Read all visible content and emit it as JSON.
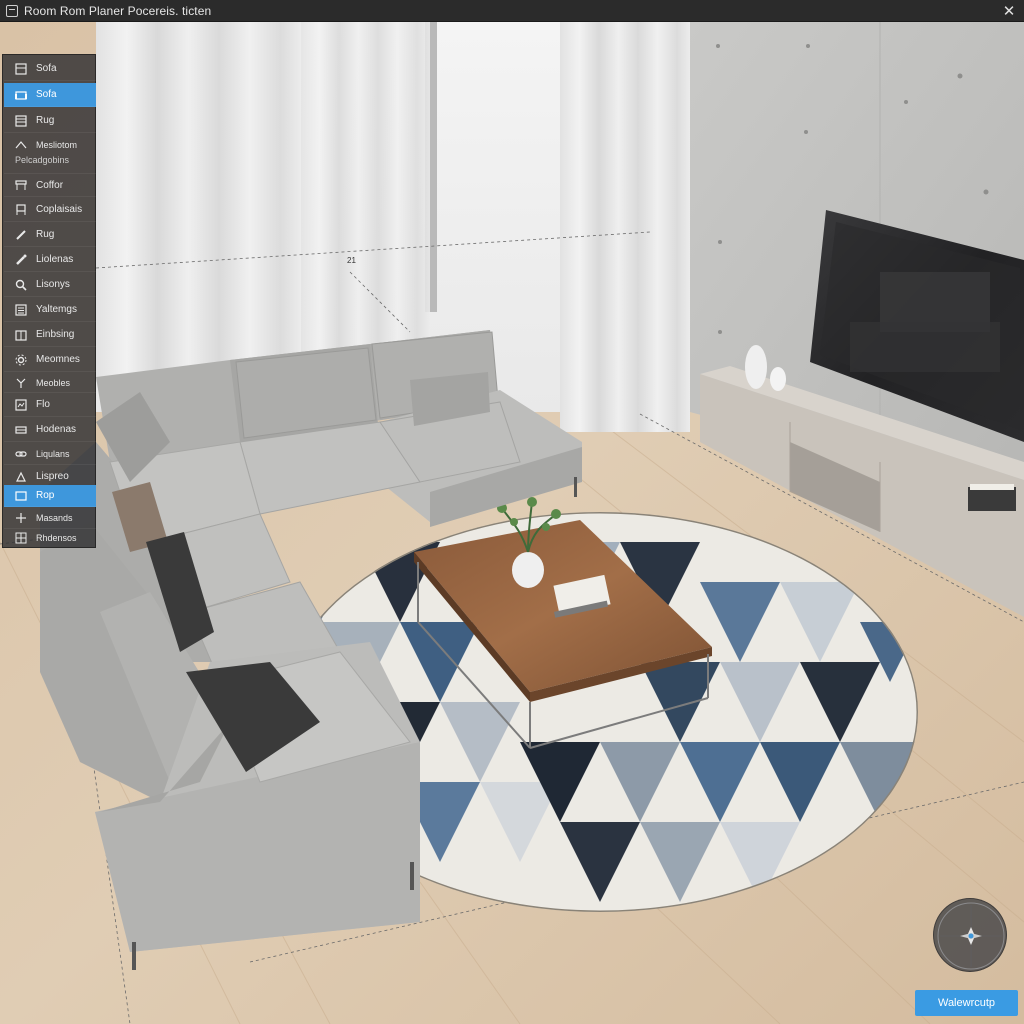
{
  "window": {
    "title": "Room Rom Planer Pocereis. ticten"
  },
  "palette": {
    "items": [
      {
        "label": "Sofa",
        "icon": "sofa-icon",
        "active": false
      },
      {
        "label": "Sofa",
        "icon": "sofa-icon",
        "active": true
      },
      {
        "label": "Rug",
        "icon": "rug-icon",
        "active": false
      },
      {
        "label": "Mesliotom",
        "icon": "measure-icon",
        "active": false
      },
      {
        "label": "Coffor",
        "icon": "table-icon",
        "active": false
      },
      {
        "label": "Coplaisais",
        "icon": "chair-icon",
        "active": false
      },
      {
        "label": "Rug",
        "icon": "pencil-icon",
        "active": false
      },
      {
        "label": "Liolenas",
        "icon": "brush-icon",
        "active": false
      },
      {
        "label": "Lisonys",
        "icon": "search-icon",
        "active": false
      },
      {
        "label": "Yaltemgs",
        "icon": "list-icon",
        "active": false
      },
      {
        "label": "Einbsing",
        "icon": "cabinet-icon",
        "active": false
      },
      {
        "label": "Meomnes",
        "icon": "settings-icon",
        "active": false
      },
      {
        "label": "Meobles",
        "icon": "plant-icon",
        "active": false
      },
      {
        "label": "Flo",
        "icon": "floor-icon",
        "active": false
      },
      {
        "label": "Hodenas",
        "icon": "shelf-icon",
        "active": false
      },
      {
        "label": "Liqulans",
        "icon": "link-icon",
        "active": false
      },
      {
        "label": "Lispreo",
        "icon": "light-icon",
        "active": false
      },
      {
        "label": "Rop",
        "icon": "box-icon",
        "active": true
      },
      {
        "label": "Masands",
        "icon": "move-icon",
        "active": false
      },
      {
        "label": "Rhdensos",
        "icon": "grid-icon",
        "active": false
      }
    ],
    "subtitle": "Pelcadgobins"
  },
  "dimension": {
    "label": "21"
  },
  "compass": {
    "icon": "compass-icon"
  },
  "walkthrough_button": {
    "label": "Walewrcutp"
  },
  "colors": {
    "accent": "#3e97dc",
    "button": "#3a9be3",
    "titlebar": "#2b2b2b"
  }
}
